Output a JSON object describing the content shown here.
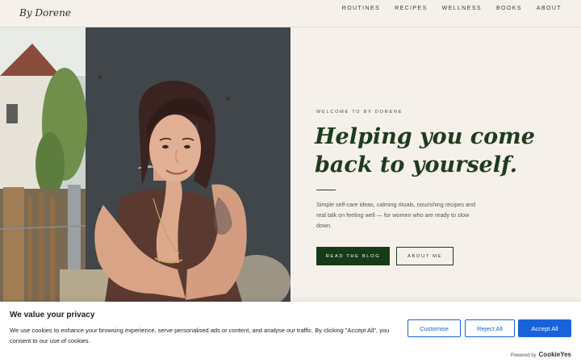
{
  "header": {
    "logo": "By Dorene",
    "nav": [
      "ROUTINES",
      "RECIPES",
      "WELLNESS",
      "BOOKS",
      "ABOUT"
    ]
  },
  "hero": {
    "eyebrow": "WELCOME TO BY DORENE",
    "headline": "Helping you come back to yourself.",
    "lede": "Simple self-care ideas, calming rituals, nourishing recipes and real talk on feeling well — for women who are ready to slow down.",
    "primary_button": "READ THE BLOG",
    "secondary_button": "ABOUT ME"
  },
  "cookie_banner": {
    "title": "We value your privacy",
    "text": "We use cookies to enhance your browsing experience, serve personalised ads or content, and analyse our traffic. By clicking \"Accept All\", you consent to our use of cookies.",
    "customise": "Customise",
    "reject": "Reject All",
    "accept": "Accept All",
    "powered_by": "Powered by",
    "brand": "CookieYes"
  },
  "colors": {
    "background": "#f5f1ea",
    "headline_green": "#1f3b1e",
    "button_green": "#173a17",
    "cookie_blue": "#1863dc"
  }
}
